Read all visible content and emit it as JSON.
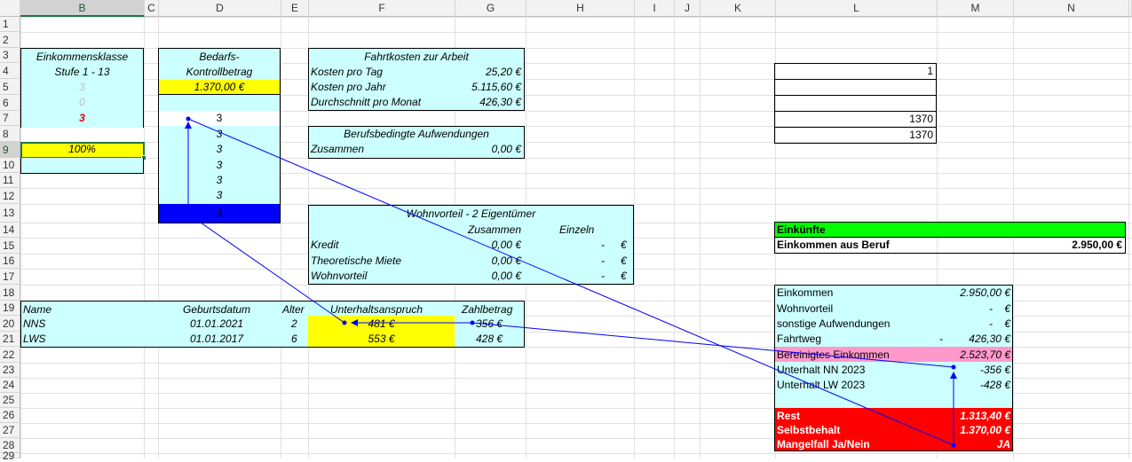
{
  "columns": [
    "B",
    "C",
    "D",
    "E",
    "F",
    "G",
    "H",
    "I",
    "J",
    "K",
    "L",
    "M",
    "N"
  ],
  "rows": [
    "1",
    "2",
    "3",
    "4",
    "5",
    "6",
    "7",
    "8",
    "9",
    "10",
    "11",
    "12",
    "13",
    "14",
    "15",
    "16",
    "17",
    "18",
    "19",
    "20",
    "21",
    "22",
    "23",
    "24",
    "25",
    "26",
    "27",
    "28",
    "29"
  ],
  "einkommensklasse": {
    "title1": "Einkommensklasse",
    "title2": "Stufe 1 - 13",
    "v5": "3",
    "v6": "0",
    "v7": "3",
    "pct": "100%"
  },
  "bedarfs": {
    "title1": "Bedarfs-",
    "title2": "Kontrollbetrag",
    "amount": "1.370,00 €",
    "values": [
      "3",
      "3",
      "3",
      "3",
      "3",
      "3",
      "3"
    ]
  },
  "fahrtkosten": {
    "title": "Fahrtkosten zur Arbeit",
    "rows": [
      {
        "label": "Kosten pro Tag",
        "value": "25,20 €"
      },
      {
        "label": "Kosten pro Jahr",
        "value": "5.115,60 €"
      },
      {
        "label": "Durchschnitt pro Monat",
        "value": "426,30 €"
      }
    ]
  },
  "berufsbedingt": {
    "title": "Berufsbedingte Aufwendungen",
    "label": "Zusammen",
    "value": "0,00 €"
  },
  "wohnvorteil": {
    "title": "Wohnvorteil - 2 Eigentümer",
    "col1": "Zusammen",
    "col2": "Einzeln",
    "rows": [
      {
        "label": "Kredit",
        "zusammen": "0,00 €",
        "einzeln": "-",
        "euro": "€"
      },
      {
        "label": "Theoretische Miete",
        "zusammen": "0,00 €",
        "einzeln": "-",
        "euro": "€"
      },
      {
        "label": "Wohnvorteil",
        "zusammen": "0,00 €",
        "einzeln": "-",
        "euro": "€"
      }
    ]
  },
  "kinder": {
    "headers": {
      "name": "Name",
      "geb": "Geburtsdatum",
      "alter": "Alter",
      "anspruch": "Unterhaltsanspruch",
      "zahl": "Zahlbetrag"
    },
    "rows": [
      {
        "name": "NNS",
        "geb": "01.01.2021",
        "alter": "2",
        "anspruch": "481 €",
        "zahl": "356 €"
      },
      {
        "name": "LWS",
        "geb": "01.01.2017",
        "alter": "6",
        "anspruch": "553 €",
        "zahl": "428 €"
      }
    ]
  },
  "lbox": {
    "v4": "1",
    "v7": "1370",
    "v8": "1370"
  },
  "einkuenfte": {
    "title": "Einkünfte",
    "label": "Einkommen aus Beruf",
    "value": "2.950,00 €"
  },
  "summary": {
    "rows": [
      {
        "label": "Einkommen",
        "prefix": "",
        "value": "2.950,00 €"
      },
      {
        "label": "Wohnvorteil",
        "prefix": "",
        "value": "-    €"
      },
      {
        "label": "sonstige Aufwendungen",
        "prefix": "",
        "value": "-    €"
      },
      {
        "label": "Fahrtweg",
        "prefix": "-",
        "value": "426,30 €"
      },
      {
        "label": "Bereinigtes Einkommen",
        "prefix": "",
        "value": "2.523,70 €"
      },
      {
        "label": "Unterhalt NN 2023",
        "prefix": "",
        "value": "-356 €"
      },
      {
        "label": "Unterhalt LW 2023",
        "prefix": "",
        "value": "-428 €"
      }
    ],
    "rest_label": "Rest",
    "rest_value": "1.313,40 €",
    "selbst_label": "Selbstbehalt",
    "selbst_value": "1.370,00 €",
    "mangel_label": "Mangelfall Ja/Nein",
    "mangel_value": "JA"
  },
  "colors": {
    "cyan": "#ccffff",
    "yellow": "#ffff00",
    "blue": "#0000ff",
    "green": "#00ff00",
    "pink": "#ff99cc",
    "red": "#ff0000",
    "arrow": "#0000ff"
  }
}
